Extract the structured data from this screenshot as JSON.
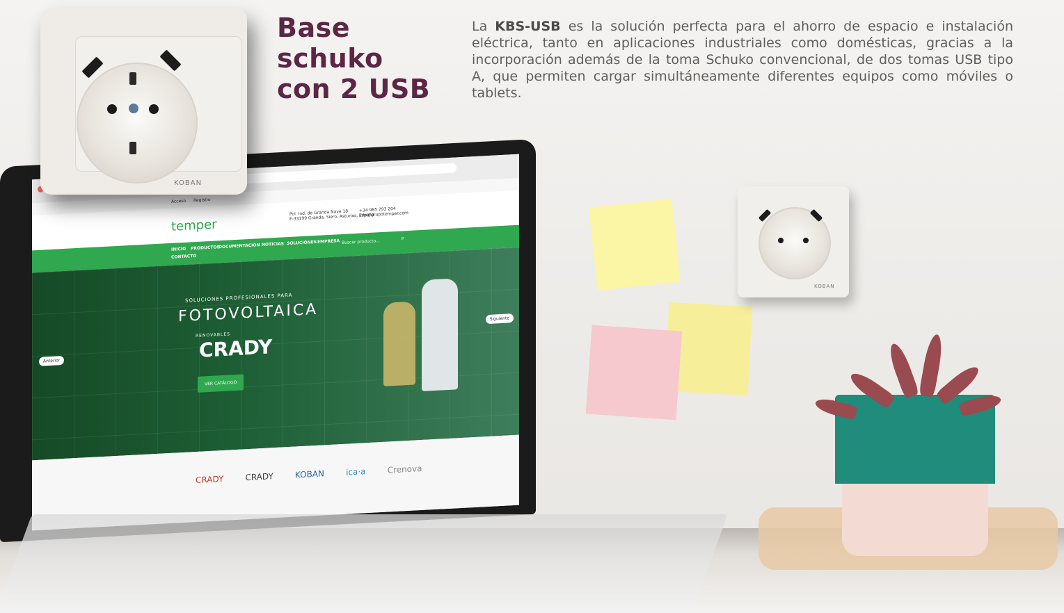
{
  "header": {
    "title_line1": "Base schuko",
    "title_line2": "con 2 USB",
    "description_prefix": "La ",
    "description_bold": "KBS-USB",
    "description_rest": " es la solución perfecta para el ahorro de espacio e instalación eléctrica, tanto en aplicaciones industriales como domésticas, gracias a la incorporación además de la toma Schuko convencional, de dos tomas USB tipo A, que permiten cargar simultáneamente diferentes equipos como móviles o tablets."
  },
  "product": {
    "brand": "KOBAN"
  },
  "laptop_site": {
    "top_links": [
      "Acceso",
      "Registro"
    ],
    "logo": "temper",
    "address": "Pol. Ind. de Granda Nave 18\nE-33199 Granda, Siero, Asturias, España",
    "contact": "+34 985 793 204\ninfo@grupotemper.com",
    "nav": [
      "INICIO",
      "PRODUCTOS",
      "DOCUMENTACIÓN",
      "NOTICIAS",
      "SOLUCIONES",
      "EMPRESA",
      "CONTACTO"
    ],
    "search_placeholder": "Buscar producto...",
    "hero_small": "SOLUCIONES PROFESIONALES PARA",
    "hero_big": "FOTOVOLTAICA",
    "hero_brand_small": "RENOVABLES",
    "hero_brand": "CRADY",
    "hero_button": "VER CATÁLOGO",
    "prev_label": "Anterior",
    "next_label": "Siguiente",
    "partner_logos": [
      "CRADY",
      "CRADY",
      "KOBAN",
      "ica·a",
      "Crenova"
    ]
  },
  "wall_socket": {
    "brand": "KOBAN"
  },
  "colors": {
    "title": "#5b2745",
    "text": "#5e5e5e",
    "site_green": "#2fa84f",
    "pot_green": "#1f8c7c",
    "note_yellow": "#fbf5a6",
    "note_pink": "#f6c9cf"
  }
}
